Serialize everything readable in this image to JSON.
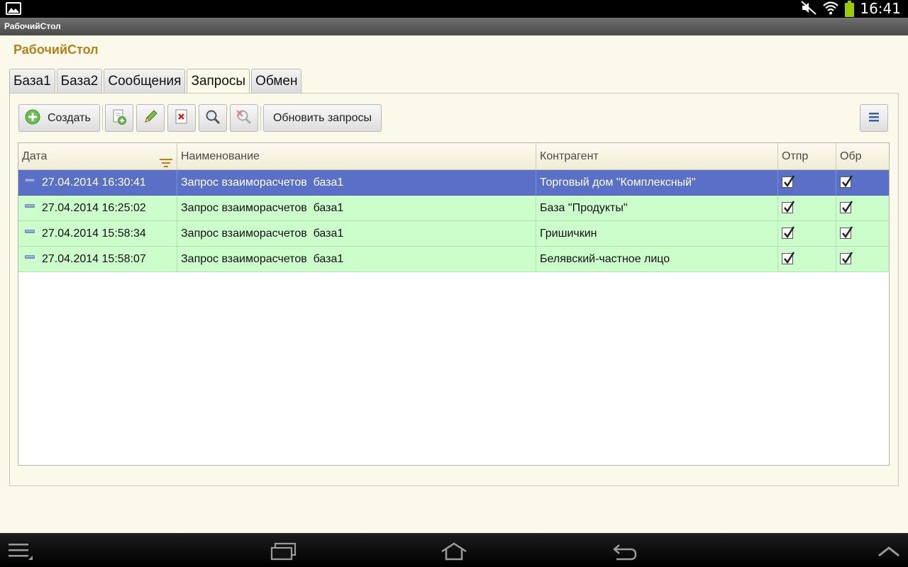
{
  "statusbar": {
    "time": "16:41"
  },
  "app": {
    "window_title": "РабочийСтол",
    "form_title": "РабочийСтол"
  },
  "tabs": [
    {
      "label": "База1",
      "active": false
    },
    {
      "label": "База2",
      "active": false
    },
    {
      "label": "Сообщения",
      "active": false
    },
    {
      "label": "Запросы",
      "active": true
    },
    {
      "label": "Обмен",
      "active": false
    }
  ],
  "toolbar": {
    "create_label": "Создать",
    "refresh_label": "Обновить запросы"
  },
  "grid": {
    "columns": [
      "Дата",
      "Наименование",
      "Контрагент",
      "Отпр",
      "Обр"
    ],
    "rows": [
      {
        "date": "27.04.2014 16:30:41",
        "name": "Запрос взаиморасчетов  база1",
        "counterparty": "Торговый дом \"Комплексный\"",
        "sent": true,
        "processed": true,
        "selected": true
      },
      {
        "date": "27.04.2014 16:25:02",
        "name": "Запрос взаиморасчетов  база1",
        "counterparty": "База \"Продукты\"",
        "sent": true,
        "processed": true,
        "selected": false
      },
      {
        "date": "27.04.2014 15:58:34",
        "name": "Запрос взаиморасчетов  база1",
        "counterparty": "Гришичкин",
        "sent": true,
        "processed": true,
        "selected": false
      },
      {
        "date": "27.04.2014 15:58:07",
        "name": "Запрос взаиморасчетов  база1",
        "counterparty": "Белявский-частное лицо",
        "sent": true,
        "processed": true,
        "selected": false
      }
    ]
  },
  "colors": {
    "accent_title": "#b5811a",
    "row_green": "#ccfecc",
    "row_selected": "#5a6fc6",
    "panel_bg": "#fbf9ea"
  }
}
